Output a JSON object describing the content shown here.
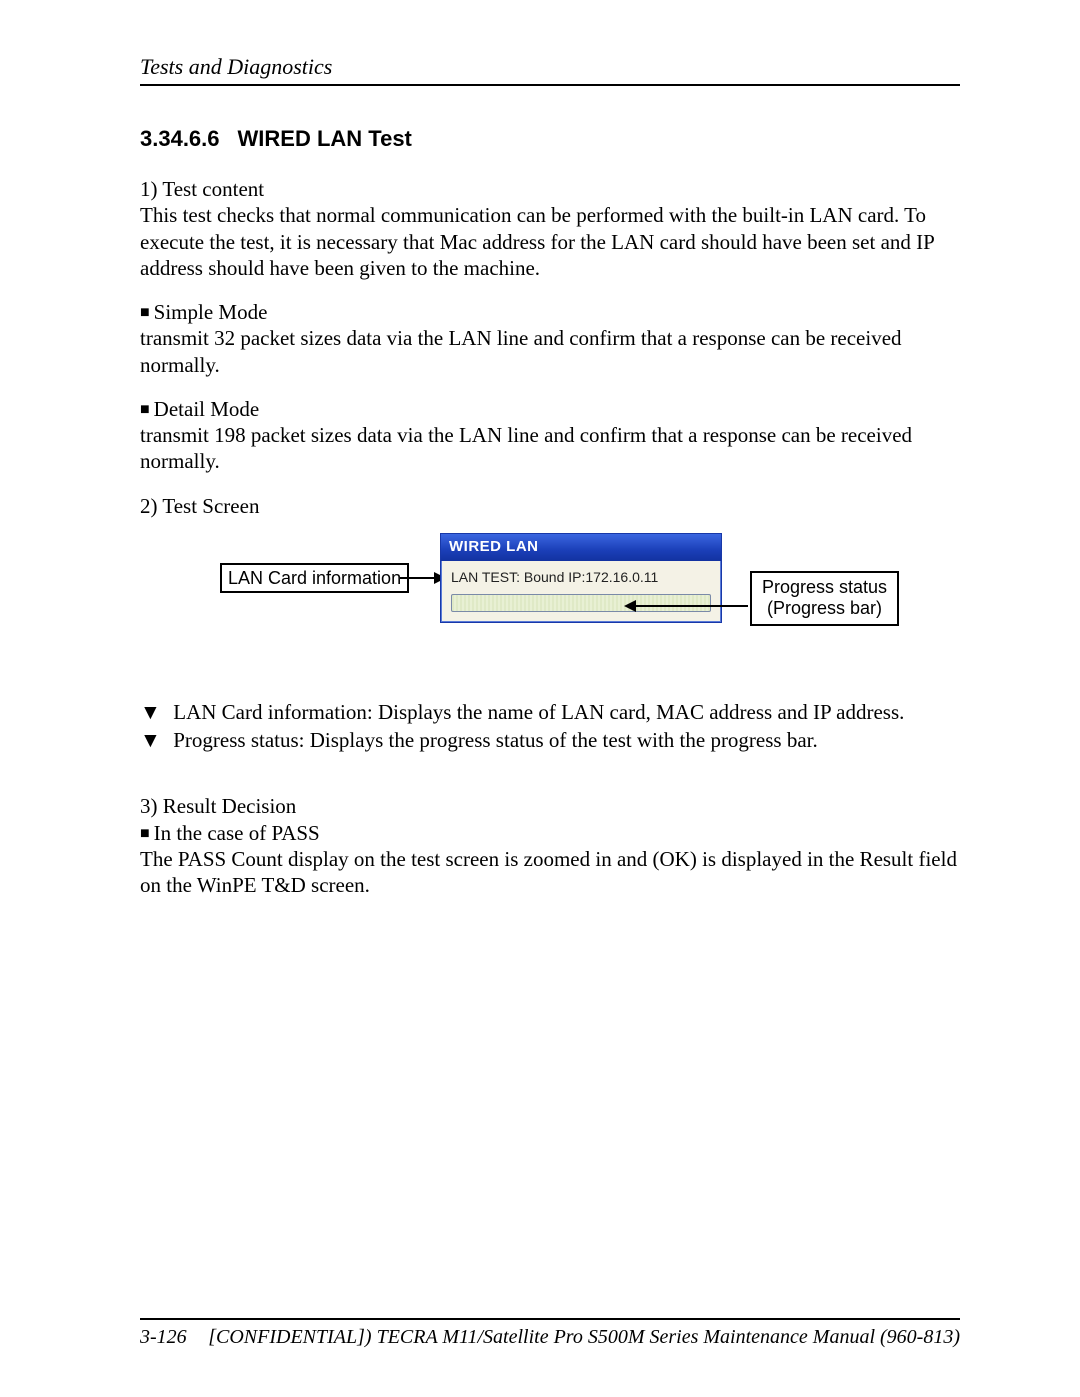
{
  "header": {
    "running_title": "Tests and Diagnostics"
  },
  "section": {
    "number": "3.34.6.6",
    "title": "WIRED LAN Test"
  },
  "content": {
    "p1_label": "1) Test content",
    "p1_body": "This test checks that normal communication can be performed with the built-in LAN card. To execute the test, it is necessary that Mac address for the LAN card should have been set and IP address should have been given to the machine.",
    "simple_mode_title": "Simple Mode",
    "simple_mode_body": "transmit 32 packet sizes data via the LAN line and confirm that a response can be received normally.",
    "detail_mode_title": "Detail Mode",
    "detail_mode_body": "transmit 198 packet sizes data via the LAN line and confirm that a response can be received normally.",
    "p2_label": "2) Test Screen",
    "diagram": {
      "lan_info_label": "LAN Card information",
      "progress_label_l1": "Progress status",
      "progress_label_l2": "(Progress bar)",
      "window_title": "WIRED LAN",
      "window_status": "LAN TEST: Bound IP:172.16.0.11"
    },
    "desc1": "LAN Card information: Displays the name of LAN card, MAC address and IP address.",
    "desc2": "Progress status: Displays the progress status of the test with the progress bar.",
    "p3_label": "3) Result Decision",
    "pass_title": "In the case of PASS",
    "pass_body": "The PASS Count display on the test screen is zoomed in and (OK) is displayed in the Result field on the WinPE T&D screen."
  },
  "footer": {
    "page_no": "3-126",
    "text": "[CONFIDENTIAL]) TECRA M11/Satellite Pro S500M Series Maintenance Manual (960-813)"
  }
}
